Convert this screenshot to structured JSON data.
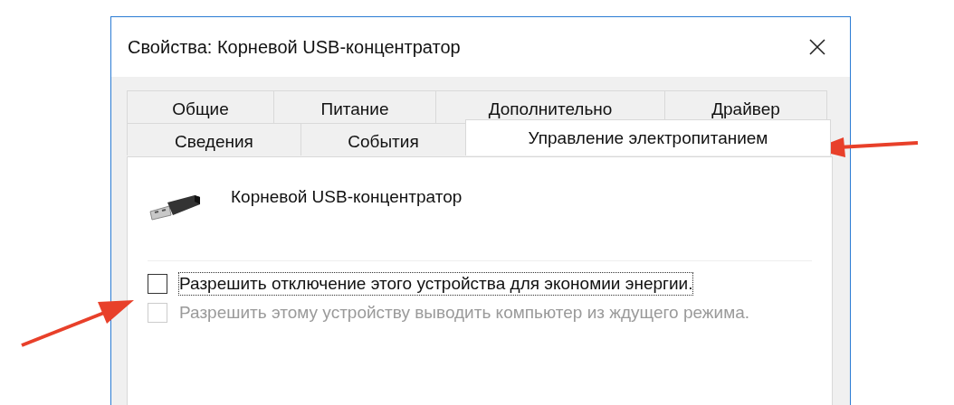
{
  "window": {
    "title": "Свойства: Корневой USB-концентратор"
  },
  "tab_rows": [
    [
      {
        "label": "Общие",
        "selected": false
      },
      {
        "label": "Питание",
        "selected": false
      },
      {
        "label": "Дополнительно",
        "selected": false
      },
      {
        "label": "Драйвер",
        "selected": false
      }
    ],
    [
      {
        "label": "Сведения",
        "selected": false
      },
      {
        "label": "События",
        "selected": false
      },
      {
        "label": "Управление электропитанием",
        "selected": true
      }
    ]
  ],
  "device": {
    "name": "Корневой USB-концентратор"
  },
  "options": [
    {
      "label": "Разрешить отключение этого устройства для экономии энергии.",
      "checked": false,
      "disabled": false,
      "focused": true
    },
    {
      "label": "Разрешить этому устройству выводить компьютер из ждущего режима.",
      "checked": false,
      "disabled": true,
      "focused": false
    }
  ]
}
